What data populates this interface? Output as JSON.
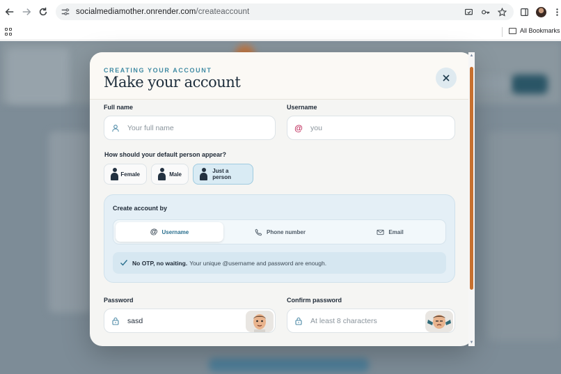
{
  "browser": {
    "url_host": "socialmediamother.onrender.com",
    "url_path": "/createaccount",
    "bookmarks_label": "All Bookmarks"
  },
  "modal": {
    "eyebrow": "CREATING YOUR ACCOUNT",
    "title": "Make your account",
    "full_name": {
      "label": "Full name",
      "placeholder": "Your full name"
    },
    "username": {
      "label": "Username",
      "placeholder": "you",
      "icon": "@"
    },
    "appearance": {
      "question": "How should your default person appear?",
      "options": [
        "Female",
        "Male",
        "Just a person"
      ],
      "selected": "Just a person"
    },
    "create_by": {
      "title": "Create account by",
      "options": [
        "Username",
        "Phone number",
        "Email"
      ],
      "selected": "Username",
      "note_bold": "No OTP, no waiting.",
      "note_text": "Your unique @username and password are enough."
    },
    "password": {
      "label": "Password",
      "value": "sasd"
    },
    "confirm_password": {
      "label": "Confirm password",
      "placeholder": "At least 8 characters"
    }
  },
  "colors": {
    "accent": "#3f8aa3",
    "selected_bg": "#d9ebf4",
    "scroll_thumb": "#c7702f",
    "username_at": "#c0305f"
  }
}
